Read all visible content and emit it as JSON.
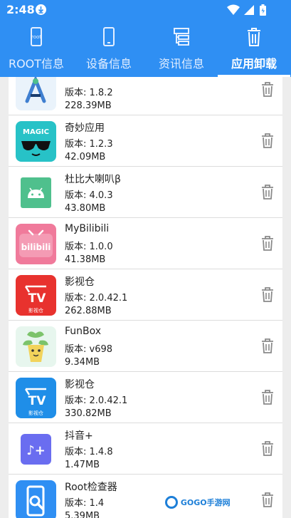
{
  "status_bar": {
    "time": "2:48"
  },
  "tabs": [
    {
      "label": "ROOT信息",
      "icon": "root-phone-icon",
      "badge": "root",
      "active": false
    },
    {
      "label": "设备信息",
      "icon": "phone-icon",
      "active": false
    },
    {
      "label": "资讯信息",
      "icon": "news-icon",
      "active": false
    },
    {
      "label": "应用卸载",
      "icon": "trash-icon",
      "active": true
    }
  ],
  "apps": [
    {
      "name": "",
      "version": "版本: 1.8.2",
      "size": "228.39MB",
      "icon": "android-studio-icon",
      "color": "#eaf3fb"
    },
    {
      "name": "奇妙应用",
      "version": "版本: 1.2.3",
      "size": "42.09MB",
      "icon": "magic-sunglasses-icon",
      "color": "#27c2c7",
      "icon_text": "MAGIC"
    },
    {
      "name": "杜比大喇叭β",
      "version": "版本: 4.0.3",
      "size": "43.80MB",
      "icon": "android-robot-icon",
      "color": "#4fc08d"
    },
    {
      "name": "MyBilibili",
      "version": "版本: 1.0.0",
      "size": "41.38MB",
      "icon": "bilibili-icon",
      "color": "#f07a9b",
      "icon_text": "bilibili"
    },
    {
      "name": "影视仓",
      "version": "版本: 2.0.42.1",
      "size": "262.88MB",
      "icon": "tv-icon",
      "color": "#e8322e",
      "icon_text": "TV",
      "icon_sub": "影视仓"
    },
    {
      "name": "FunBox",
      "version": "版本: v698",
      "size": "9.34MB",
      "icon": "plant-pot-icon",
      "color": "#e7f6ee"
    },
    {
      "name": "影视仓",
      "version": "版本: 2.0.42.1",
      "size": "330.82MB",
      "icon": "tv-icon",
      "color": "#1f8ee8",
      "icon_text": "TV",
      "icon_sub": "影视仓"
    },
    {
      "name": "抖音+",
      "version": "版本: 1.4.8",
      "size": "1.47MB",
      "icon": "douyin-plus-icon",
      "color": "#6a6df0",
      "icon_text": "♪+"
    },
    {
      "name": "Root检查器",
      "version": "版本: 1.4",
      "size": "5.39MB",
      "icon": "root-checker-icon",
      "color": "#2f8ff3"
    }
  ],
  "watermark": {
    "text": "GOGO手游网"
  }
}
